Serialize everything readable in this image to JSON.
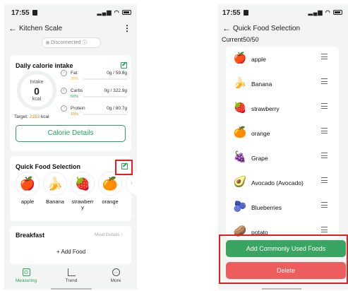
{
  "status": {
    "time": "17:55"
  },
  "left": {
    "title": "Kitchen Scale",
    "connection": "Disconnected",
    "calorie_card": {
      "title": "Daily calorie intake",
      "ring_top": "Intake",
      "ring_value": "0",
      "ring_unit": "kcal",
      "target_label": "Target:",
      "target_value": "2153",
      "target_unit": "kcal",
      "macros": [
        {
          "name": "Fat",
          "pct": "25%",
          "value": "0g / 59.8g",
          "color": "#e6c229"
        },
        {
          "name": "Carbs",
          "pct": "60%",
          "value": "0g / 322.9g",
          "color": "#27a45a"
        },
        {
          "name": "Protein",
          "pct": "15%",
          "value": "0g / 80.7g",
          "color": "#e08a12"
        }
      ],
      "details_button": "Calorie Details"
    },
    "quick_food": {
      "title": "Quick Food Selection",
      "items": [
        {
          "label": "apple",
          "icon": "apple-icon",
          "glyph": "🍎"
        },
        {
          "label": "Banana",
          "icon": "banana-icon",
          "glyph": "🍌"
        },
        {
          "label": "strawberr\ny",
          "icon": "strawberry-icon",
          "glyph": "🍓"
        },
        {
          "label": "orange",
          "icon": "orange-icon",
          "glyph": "🍊"
        }
      ]
    },
    "breakfast": {
      "title": "Breakfast",
      "details": "Meal Details",
      "add": "+ Add Food"
    },
    "tabs": [
      {
        "label": "Measuring",
        "icon": "scale-icon"
      },
      {
        "label": "Trend",
        "icon": "trend-icon"
      },
      {
        "label": "More",
        "icon": "more-icon"
      }
    ]
  },
  "right": {
    "title": "Quick Food Selection",
    "current": "Current50/50",
    "foods": [
      {
        "name": "apple",
        "icon": "apple-icon",
        "glyph": "🍎"
      },
      {
        "name": "Banana",
        "icon": "banana-icon",
        "glyph": "🍌"
      },
      {
        "name": "strawberry",
        "icon": "strawberry-icon",
        "glyph": "🍓"
      },
      {
        "name": "orange",
        "icon": "orange-icon",
        "glyph": "🍊"
      },
      {
        "name": "Grape",
        "icon": "grape-icon",
        "glyph": "🍇"
      },
      {
        "name": "Avocado (Avocado)",
        "icon": "avocado-icon",
        "glyph": "🥑"
      },
      {
        "name": "Blueberries",
        "icon": "blueberries-icon",
        "glyph": "🫐"
      },
      {
        "name": "potato",
        "icon": "potato-icon",
        "glyph": "🥔"
      }
    ],
    "add_button": "Add Commonly Used Foods",
    "delete_button": "Delete"
  }
}
